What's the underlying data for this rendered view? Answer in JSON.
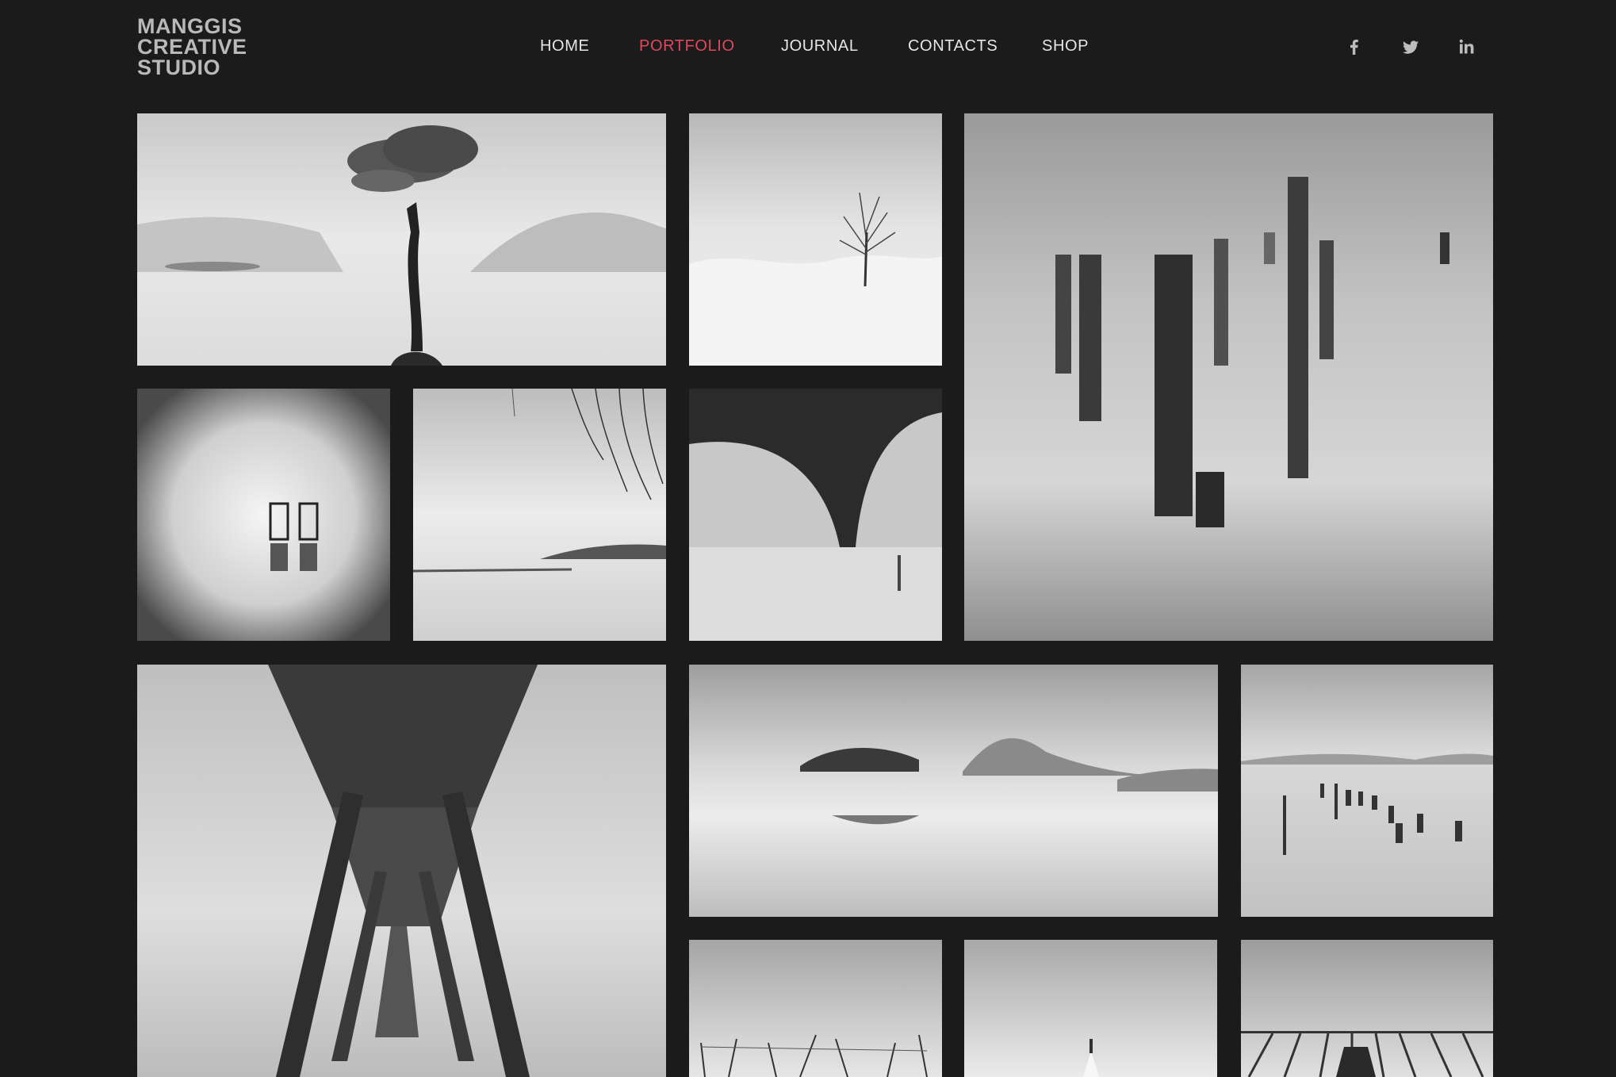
{
  "brand": {
    "line1": "MANGGIS",
    "line2": "CREATIVE",
    "line3": "STUDIO"
  },
  "nav": {
    "items": [
      {
        "label": "HOME"
      },
      {
        "label": "PORTFOLIO"
      },
      {
        "label": "JOURNAL"
      },
      {
        "label": "CONTACTS"
      },
      {
        "label": "SHOP"
      }
    ],
    "active": "PORTFOLIO"
  },
  "social": [
    "facebook-icon",
    "twitter-icon",
    "linkedin-icon"
  ],
  "colors": {
    "background": "#1b1b1c",
    "accent": "#e0485e",
    "nav_text": "#e6e6e6",
    "logo": "#b9b9b9"
  },
  "gallery": {
    "photos": [
      "lone-tree-lake",
      "bare-tree-snow",
      "wooden-posts-water",
      "two-chairs-water",
      "willow-branches-lake",
      "bridge-in-fog",
      "pier-underside",
      "misty-island",
      "posts-in-lake",
      "fishing-nets",
      "small-boat-pier",
      "pier-rows"
    ]
  }
}
